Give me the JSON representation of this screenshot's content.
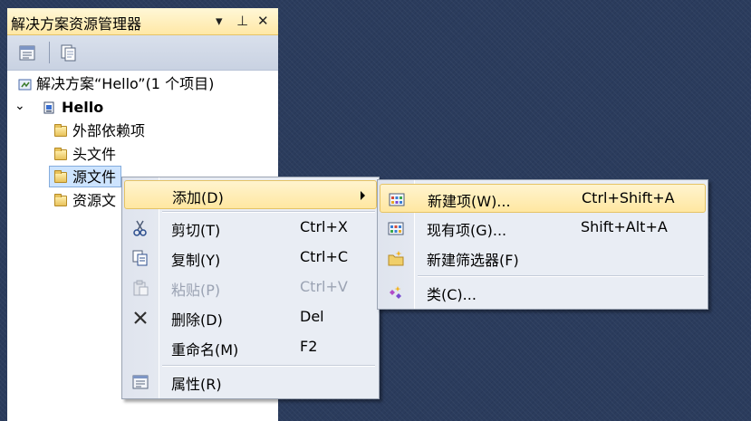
{
  "panel": {
    "title": "解决方案资源管理器",
    "buttons": {
      "dropdown": "▾",
      "pin": "⊥",
      "close": "✕"
    }
  },
  "tree": {
    "solution": "解决方案“Hello”(1 个项目)",
    "project": "Hello",
    "expander": "⌄",
    "items": [
      "外部依赖项",
      "头文件",
      "源文件",
      "资源文"
    ]
  },
  "context_menu": {
    "items": [
      {
        "label": "添加(D)",
        "shortcut": "",
        "submenu": true
      },
      {
        "label": "剪切(T)",
        "shortcut": "Ctrl+X",
        "icon": "scissors-icon"
      },
      {
        "label": "复制(Y)",
        "shortcut": "Ctrl+C",
        "icon": "copy-icon"
      },
      {
        "label": "粘贴(P)",
        "shortcut": "Ctrl+V",
        "icon": "paste-icon",
        "disabled": true
      },
      {
        "label": "删除(D)",
        "shortcut": "Del",
        "icon": "delete-icon"
      },
      {
        "label": "重命名(M)",
        "shortcut": "F2"
      },
      {
        "label": "属性(R)",
        "shortcut": "",
        "icon": "properties-icon"
      }
    ]
  },
  "submenu": {
    "items": [
      {
        "label": "新建项(W)...",
        "shortcut": "Ctrl+Shift+A",
        "icon": "new-item-icon"
      },
      {
        "label": "现有项(G)...",
        "shortcut": "Shift+Alt+A",
        "icon": "existing-item-icon"
      },
      {
        "label": "新建筛选器(F)",
        "shortcut": "",
        "icon": "new-filter-icon"
      },
      {
        "label": "类(C)...",
        "shortcut": "",
        "icon": "class-icon"
      }
    ]
  },
  "colors": {
    "background": "#2b3c5d",
    "highlight": "#ffe7a1",
    "menu": "#e9edf4"
  }
}
